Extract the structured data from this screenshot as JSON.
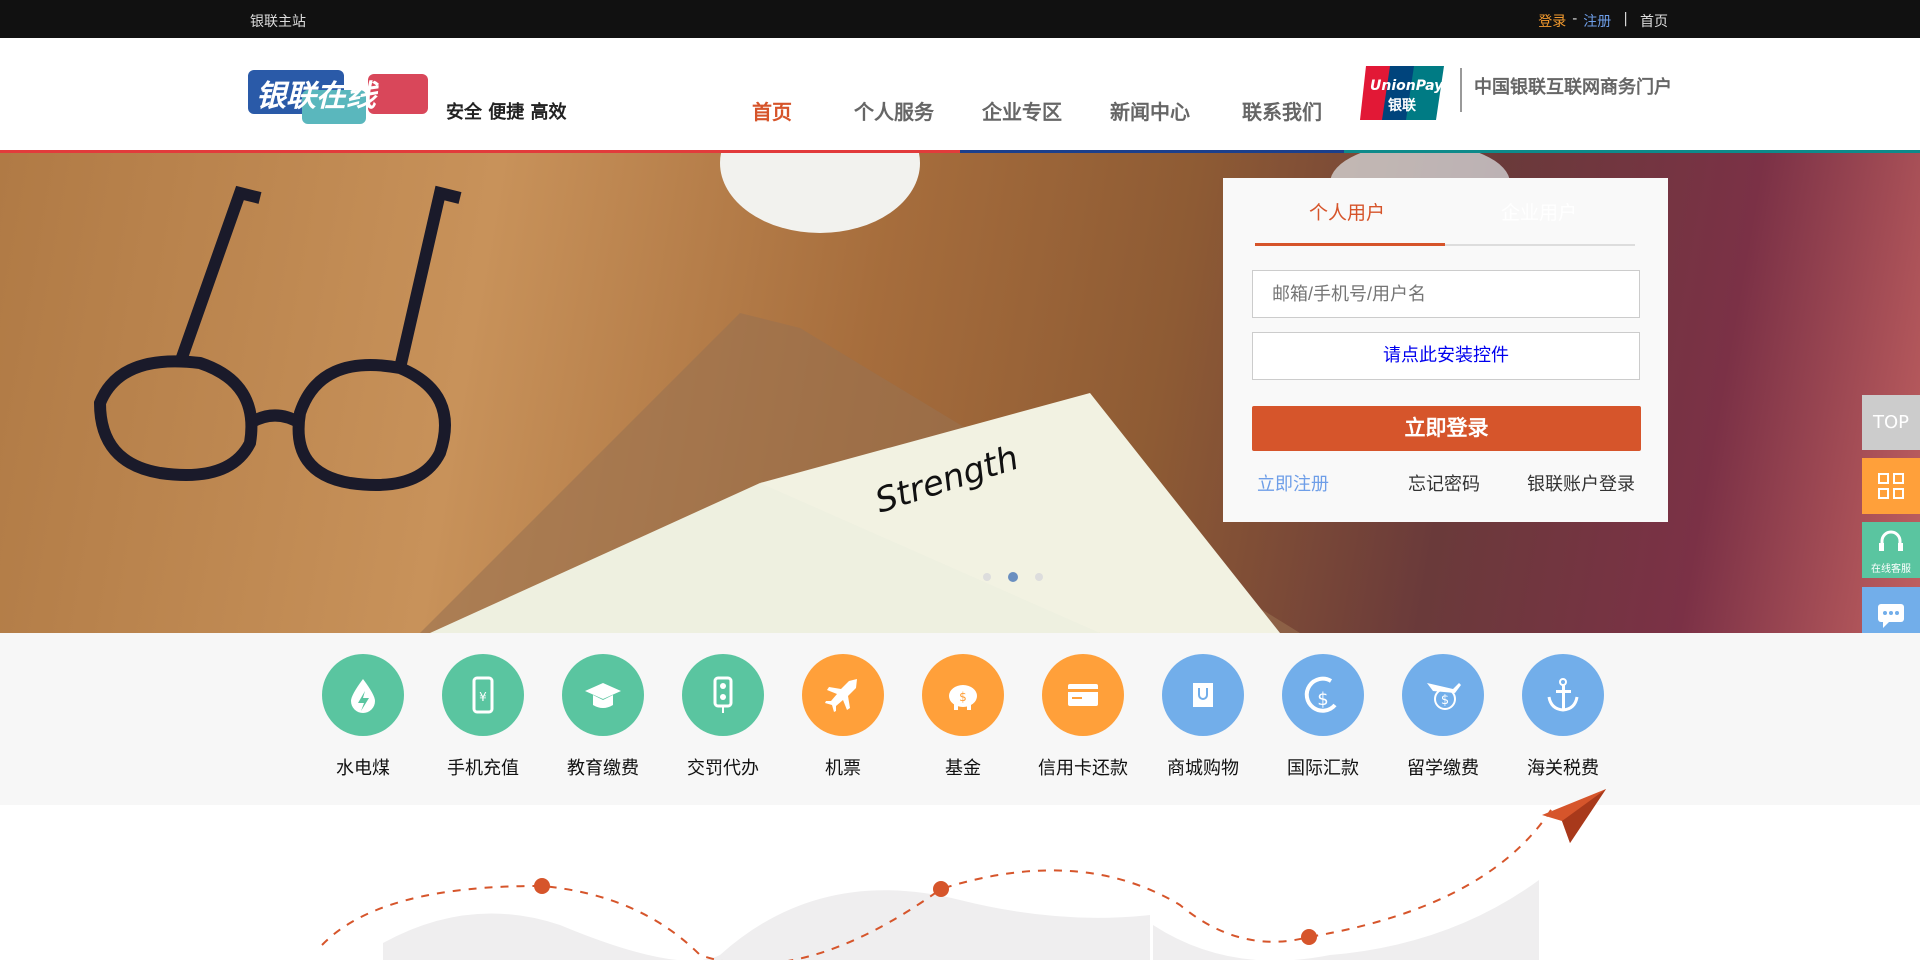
{
  "topbar": {
    "site": "银联主站",
    "login": "登录",
    "sep": "-",
    "register": "注册",
    "divider": "|",
    "home": "首页"
  },
  "header": {
    "logo_text": "银联在线",
    "slogan": "安全 便捷 高效",
    "nav": [
      "首页",
      "个人服务",
      "企业专区",
      "新闻中心",
      "联系我们"
    ],
    "active_nav": "首页",
    "unionpay_logo": "UnionPay 银联",
    "portal_text": "中国银联互联网商务门户"
  },
  "banner": {
    "notebook_word": "Strength",
    "carousel_dots": 3,
    "active_dot": 2
  },
  "login": {
    "tabs": [
      "个人用户",
      "企业用户"
    ],
    "active_tab": "个人用户",
    "username_placeholder": "邮箱/手机号/用户名",
    "install_control": "请点此安装控件",
    "submit": "立即登录",
    "register": "立即注册",
    "forgot": "忘记密码",
    "unionpay_account": "银联账户登录"
  },
  "side": {
    "top": "TOP",
    "qr_icon": "qr-code-icon",
    "service": "在线客服",
    "chat_icon": "chat-icon"
  },
  "services": [
    {
      "label": "水电煤",
      "icon": "water-drop-icon",
      "color": "#5ac5a0"
    },
    {
      "label": "手机充值",
      "icon": "phone-yuan-icon",
      "color": "#5ac5a0"
    },
    {
      "label": "教育缴费",
      "icon": "graduation-cap-icon",
      "color": "#5ac5a0"
    },
    {
      "label": "交罚代办",
      "icon": "traffic-light-icon",
      "color": "#5ac5a0"
    },
    {
      "label": "机票",
      "icon": "airplane-icon",
      "color": "#ffa03a"
    },
    {
      "label": "基金",
      "icon": "piggy-bank-icon",
      "color": "#ffa03a"
    },
    {
      "label": "信用卡还款",
      "icon": "credit-card-icon",
      "color": "#ffa03a"
    },
    {
      "label": "商城购物",
      "icon": "shopping-bag-icon",
      "color": "#72aeea"
    },
    {
      "label": "国际汇款",
      "icon": "dollar-swirl-icon",
      "color": "#72aeea"
    },
    {
      "label": "留学缴费",
      "icon": "plane-dollar-icon",
      "color": "#72aeea"
    },
    {
      "label": "海关税费",
      "icon": "anchor-icon",
      "color": "#72aeea"
    }
  ],
  "colors": {
    "accent": "#d6552b",
    "link_blue": "#6e9ee8",
    "install_blue": "#0000ee"
  }
}
